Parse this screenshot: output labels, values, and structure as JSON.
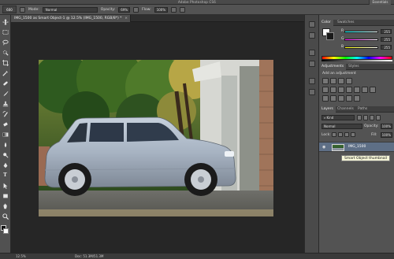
{
  "window": {
    "title": "Adobe Photoshop CS6",
    "workspace_button": "Essentials"
  },
  "options_bar": {
    "tool_size": "600",
    "mode_label": "Mode:",
    "mode_value": "Normal",
    "opacity_label": "Opacity:",
    "opacity_value": "69%",
    "flow_label": "Flow:",
    "flow_value": "100%"
  },
  "document_tab": {
    "label": "IMG_1500 as Smart Object-1 @ 12.5% (IMG_1500, RGB/8*) *",
    "close": "×"
  },
  "tools": [
    {
      "name": "move-tool-icon"
    },
    {
      "name": "marquee-tool-icon"
    },
    {
      "name": "lasso-tool-icon"
    },
    {
      "name": "quick-select-tool-icon"
    },
    {
      "name": "crop-tool-icon"
    },
    {
      "name": "eyedropper-tool-icon"
    },
    {
      "name": "healing-brush-tool-icon"
    },
    {
      "name": "brush-tool-icon"
    },
    {
      "name": "clone-stamp-tool-icon"
    },
    {
      "name": "history-brush-tool-icon"
    },
    {
      "name": "eraser-tool-icon"
    },
    {
      "name": "gradient-tool-icon"
    },
    {
      "name": "blur-tool-icon"
    },
    {
      "name": "dodge-tool-icon"
    },
    {
      "name": "pen-tool-icon"
    },
    {
      "name": "type-tool-icon"
    },
    {
      "name": "path-selection-tool-icon"
    },
    {
      "name": "shape-tool-icon"
    },
    {
      "name": "hand-tool-icon"
    },
    {
      "name": "zoom-tool-icon"
    }
  ],
  "color_panel": {
    "tabs": [
      "Color",
      "Swatches"
    ],
    "channels": [
      {
        "label": "R",
        "value": "255",
        "color": "#ff4a8a"
      },
      {
        "label": "G",
        "value": "255",
        "color": "#5ad85a"
      },
      {
        "label": "B",
        "value": "255",
        "color": "#6a7aff"
      }
    ]
  },
  "adjustments_panel": {
    "tabs": [
      "Adjustments",
      "Styles"
    ],
    "heading": "Add an adjustment"
  },
  "layers_panel": {
    "tabs": [
      "Layers",
      "Channels",
      "Paths"
    ],
    "kind_label": "Kind",
    "blend_mode": "Normal",
    "opacity_label": "Opacity:",
    "opacity_value": "100%",
    "lock_label": "Lock:",
    "fill_label": "Fill:",
    "fill_value": "100%",
    "layer_name": "IMG_1500",
    "tooltip": "Smart Object thumbnail"
  },
  "status_bar": {
    "zoom": "12.5%",
    "doc_size": "Doc: 51.3M/51.3M"
  },
  "colors": {
    "accent_selected_layer": "#5e6f86",
    "foreground": "#111111",
    "background": "#ffffff"
  }
}
